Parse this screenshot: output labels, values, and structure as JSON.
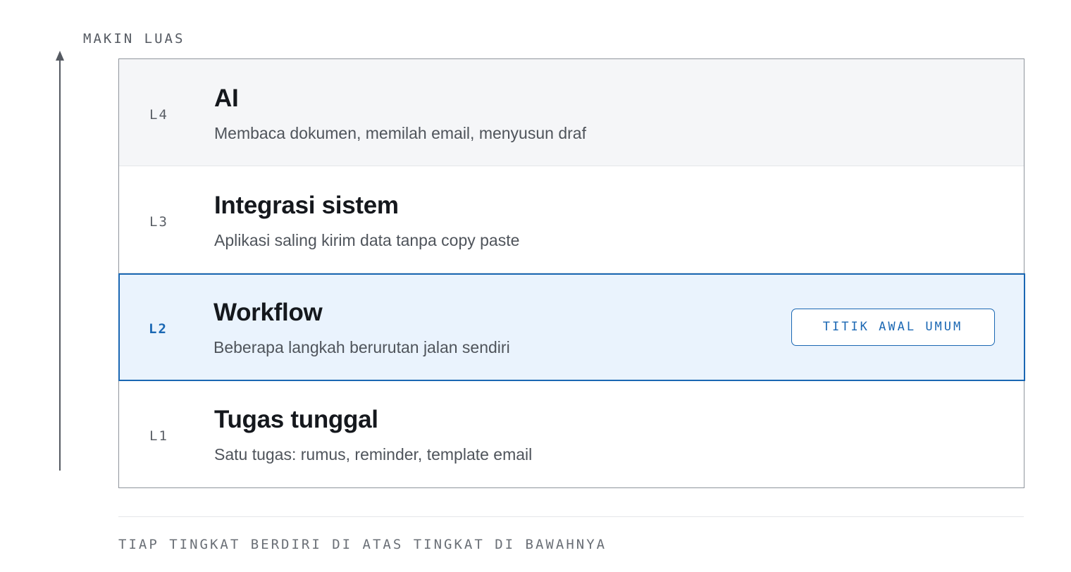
{
  "axis": {
    "label": "MAKIN LUAS"
  },
  "levels": [
    {
      "code": "L4",
      "title": "AI",
      "description": "Membaca dokumen, memilah email, menyusun draf"
    },
    {
      "code": "L3",
      "title": "Integrasi sistem",
      "description": "Aplikasi saling kirim data tanpa copy paste"
    },
    {
      "code": "L2",
      "title": "Workflow",
      "description": "Beberapa langkah berurutan jalan sendiri",
      "badge": "TITIK AWAL UMUM"
    },
    {
      "code": "L1",
      "title": "Tugas tunggal",
      "description": "Satu tugas: rumus, reminder, template email"
    }
  ],
  "footnote": "TIAP TINGKAT BERDIRI DI ATAS TINGKAT DI BAWAHNYA",
  "colors": {
    "accent": "#1a67b3",
    "highlight_bg": "#eaf3fd",
    "shaded_bg": "#f5f6f8",
    "text": "#15181d"
  }
}
